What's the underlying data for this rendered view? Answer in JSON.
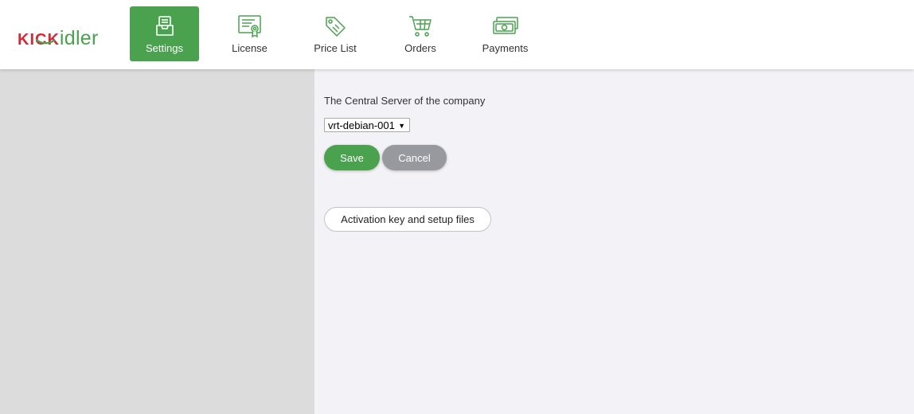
{
  "brand": {
    "part1": "KICK",
    "part2": "idler"
  },
  "colors": {
    "accent": "#4aa24f",
    "brand_red": "#d42a36",
    "cancel_gray": "#98989f"
  },
  "nav": {
    "items": [
      {
        "label": "Settings",
        "icon": "settings-tray-icon",
        "active": true
      },
      {
        "label": "License",
        "icon": "license-certificate-icon",
        "active": false
      },
      {
        "label": "Price List",
        "icon": "price-tag-icon",
        "active": false
      },
      {
        "label": "Orders",
        "icon": "shopping-cart-icon",
        "active": false
      },
      {
        "label": "Payments",
        "icon": "banknotes-icon",
        "active": false
      }
    ]
  },
  "main": {
    "server_label": "The Central Server of the company",
    "server_select": {
      "selected": "vrt-debian-001",
      "arrow": "▼"
    },
    "save_label": "Save",
    "cancel_label": "Cancel",
    "activation_label": "Activation key and setup files"
  }
}
